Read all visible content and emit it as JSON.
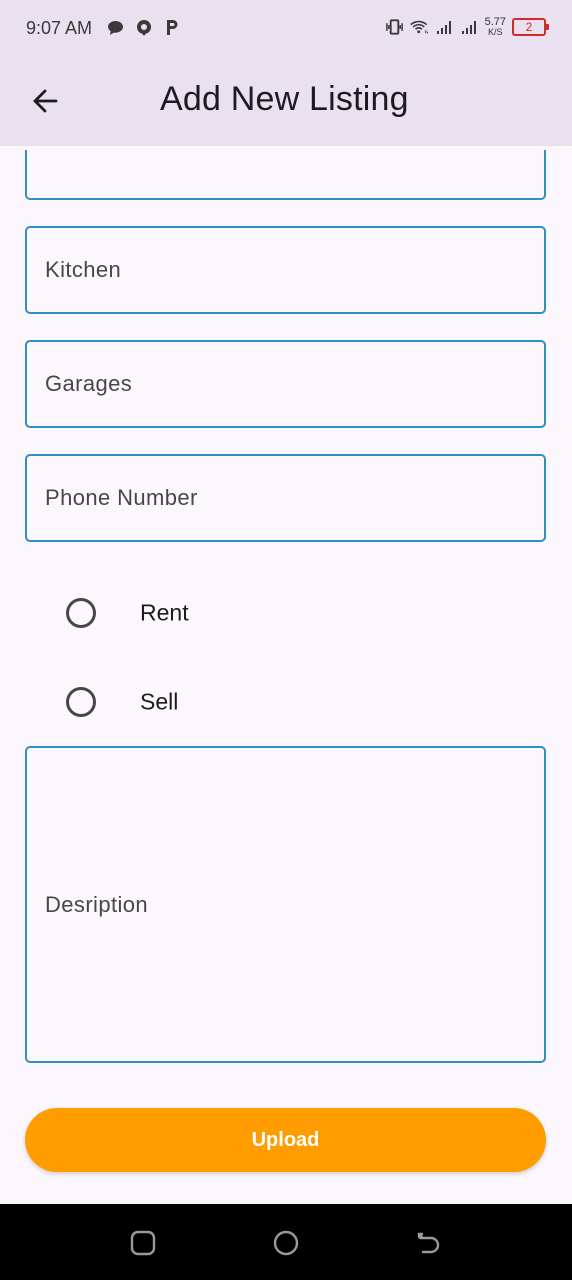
{
  "status_bar": {
    "time": "9:07 AM",
    "left_icons": [
      "chat-bubble-icon",
      "location-pin-icon",
      "p-icon"
    ],
    "net_speed_value": "5.77",
    "net_speed_unit": "K/S",
    "battery": "2",
    "battery_color": "#d02a2a"
  },
  "app_bar": {
    "title": "Add New Listing",
    "back_icon": "arrow-back-icon",
    "background": "#e9e1ef"
  },
  "form": {
    "fields": [
      {
        "placeholder": "Kitchen"
      },
      {
        "placeholder": "Garages"
      },
      {
        "placeholder": "Phone Number"
      }
    ],
    "radios": [
      {
        "label": "Rent",
        "selected": false
      },
      {
        "label": "Sell",
        "selected": false
      }
    ],
    "description_placeholder": "Desription",
    "border_color": "#2f8fbf"
  },
  "upload_button": {
    "label": "Upload",
    "color": "#ff9c00"
  },
  "nav_bar": {
    "buttons": [
      "recent-apps-icon",
      "home-icon",
      "back-icon"
    ]
  }
}
